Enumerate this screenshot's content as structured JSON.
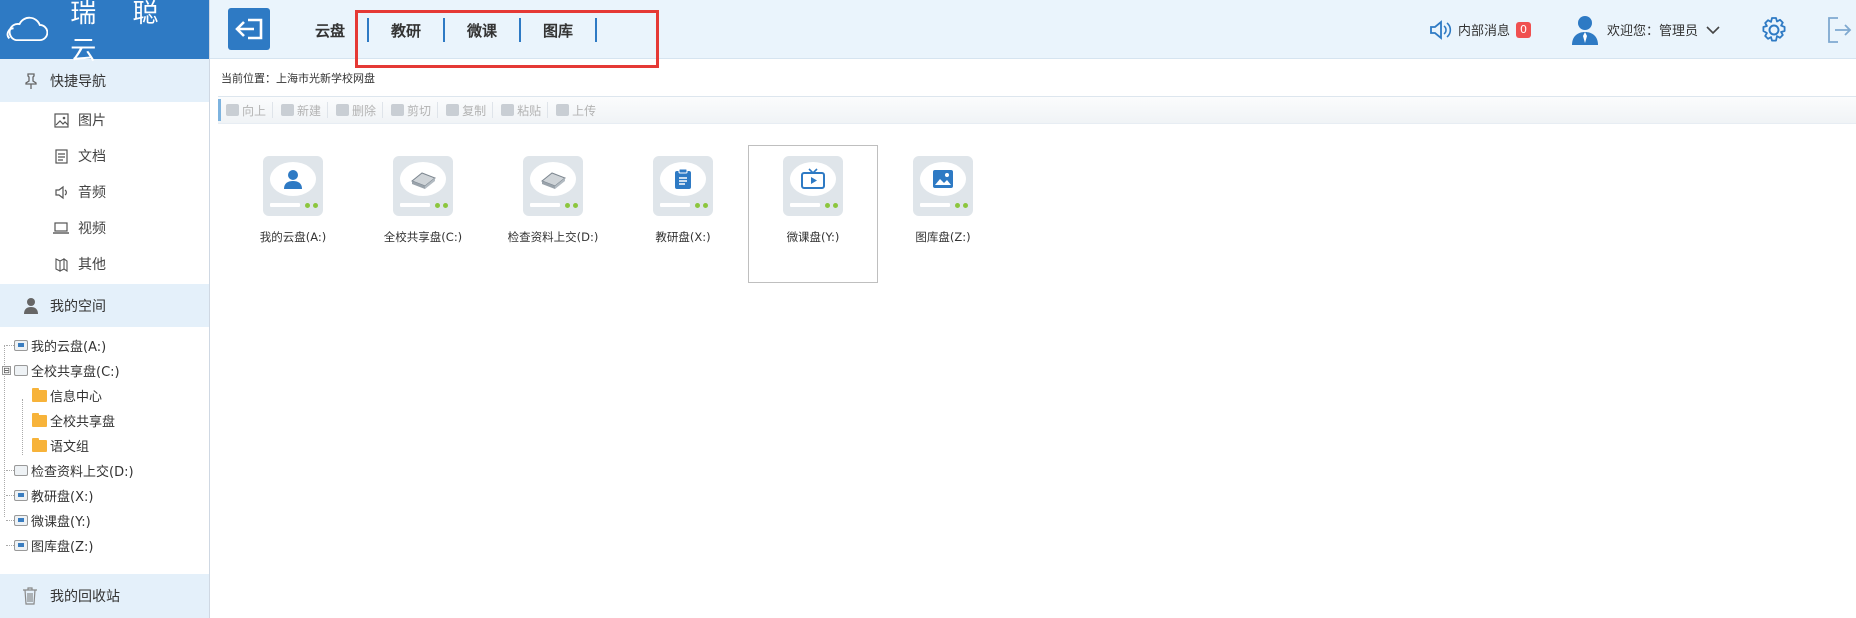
{
  "brand": {
    "name": "瑞 聪 云"
  },
  "sidebar": {
    "quick_nav": {
      "label": "快捷导航"
    },
    "quick_items": [
      {
        "label": "图片",
        "icon": "image-icon"
      },
      {
        "label": "文档",
        "icon": "document-icon"
      },
      {
        "label": "音频",
        "icon": "audio-icon"
      },
      {
        "label": "视频",
        "icon": "video-icon"
      },
      {
        "label": "其他",
        "icon": "other-icon"
      }
    ],
    "my_space": {
      "label": "我的空间"
    },
    "tree": [
      {
        "label": "我的云盘(A:)"
      },
      {
        "label": "全校共享盘(C:)",
        "toggle": "⊟"
      },
      {
        "label": "信息中心"
      },
      {
        "label": "全校共享盘"
      },
      {
        "label": "语文组"
      },
      {
        "label": "检查资料上交(D:)"
      },
      {
        "label": "教研盘(X:)"
      },
      {
        "label": "微课盘(Y:)"
      },
      {
        "label": "图库盘(Z:)"
      }
    ],
    "recycle": {
      "label": "我的回收站"
    }
  },
  "header": {
    "tabs": [
      "云盘",
      "教研",
      "微课",
      "图库"
    ],
    "message_label": "内部消息",
    "message_count": "0",
    "welcome": "欢迎您：",
    "username": "管理员"
  },
  "breadcrumb": "当前位置：上海市光新学校网盘",
  "toolbar": [
    "向上",
    "新建",
    "删除",
    "剪切",
    "复制",
    "粘贴",
    "上传"
  ],
  "drives": [
    {
      "label": "我的云盘(A:)",
      "icon": "user-drive-icon"
    },
    {
      "label": "全校共享盘(C:)",
      "icon": "hard-disk-icon"
    },
    {
      "label": "检查资料上交(D:)",
      "icon": "hard-disk-icon"
    },
    {
      "label": "教研盘(X:)",
      "icon": "clipboard-drive-icon"
    },
    {
      "label": "微课盘(Y:)",
      "icon": "tv-drive-icon",
      "selected": true
    },
    {
      "label": "图库盘(Z:)",
      "icon": "picture-drive-icon"
    }
  ],
  "colors": {
    "brand_blue": "#2e7ac4",
    "highlight_red": "#e53935",
    "badge_red": "#f05050",
    "led_green": "#8cc63e"
  }
}
